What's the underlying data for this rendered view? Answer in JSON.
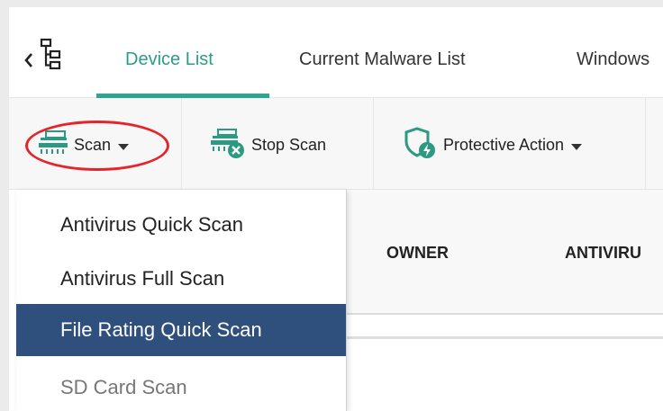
{
  "tabs": [
    {
      "label": "Device List",
      "active": true
    },
    {
      "label": "Current Malware List",
      "active": false
    },
    {
      "label": "Windows",
      "active": false
    }
  ],
  "nav": {
    "back_icon": "chevron-left-icon",
    "tree_icon": "tree-structure-icon"
  },
  "toolbar": {
    "scan_label": "Scan",
    "stop_scan_label": "Stop Scan",
    "protective_action_label": "Protective Action"
  },
  "scan_menu": {
    "items": [
      {
        "label": "Antivirus Quick Scan",
        "state": "normal"
      },
      {
        "label": "Antivirus Full Scan",
        "state": "normal"
      },
      {
        "label": "File Rating Quick Scan",
        "state": "selected"
      },
      {
        "label": "SD Card Scan",
        "state": "disabled"
      }
    ]
  },
  "table": {
    "columns": [
      "OWNER",
      "ANTIVIRU"
    ]
  },
  "colors": {
    "accent": "#2fa58f",
    "menu_selected_bg": "#2f4f7d",
    "highlight": "#e3262b",
    "icon_green": "#2c9a83"
  }
}
